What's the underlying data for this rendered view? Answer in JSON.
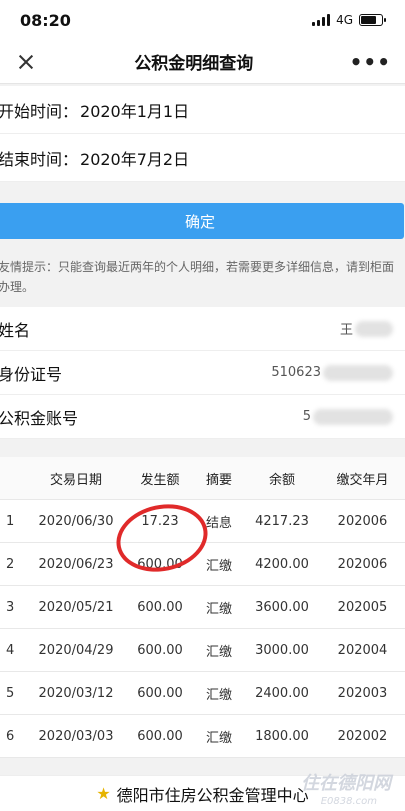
{
  "status": {
    "time": "08:20",
    "network": "4G",
    "battery_level": 0.75
  },
  "nav": {
    "title": "公积金明细查询",
    "more": "•••"
  },
  "dates": {
    "start_label": "开始时间：",
    "start_value": "2020年1月1日",
    "end_label": "结束时间：",
    "end_value": "2020年7月2日"
  },
  "confirm_label": "确定",
  "tip": "友情提示：只能查询最近两年的个人明细，若需要更多详细信息，请到柜面办理。",
  "info": {
    "name_label": "姓名",
    "name_value": "王",
    "id_label": "身份证号",
    "id_value": "510623",
    "account_label": "公积金账号",
    "account_value": "5"
  },
  "table": {
    "headers": [
      "",
      "交易日期",
      "发生额",
      "摘要",
      "余额",
      "缴交年月"
    ],
    "rows": [
      [
        "1",
        "2020/06/30",
        "17.23",
        "结息",
        "4217.23",
        "202006"
      ],
      [
        "2",
        "2020/06/23",
        "600.00",
        "汇缴",
        "4200.00",
        "202006"
      ],
      [
        "3",
        "2020/05/21",
        "600.00",
        "汇缴",
        "3600.00",
        "202005"
      ],
      [
        "4",
        "2020/04/29",
        "600.00",
        "汇缴",
        "3000.00",
        "202004"
      ],
      [
        "5",
        "2020/03/12",
        "600.00",
        "汇缴",
        "2400.00",
        "202003"
      ],
      [
        "6",
        "2020/03/03",
        "600.00",
        "汇缴",
        "1800.00",
        "202002"
      ]
    ]
  },
  "footer": {
    "text": "德阳市住房公积金管理中心",
    "icon": "emblem-icon"
  },
  "watermark": {
    "main": "住在德阳网",
    "sub": "E0838.com"
  }
}
